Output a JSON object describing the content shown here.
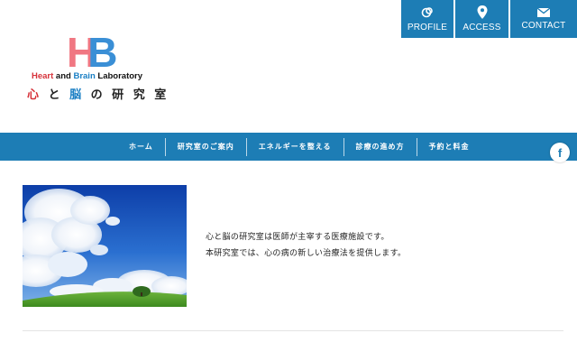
{
  "topnav": {
    "profile": "PROFILE",
    "access": "ACCESS",
    "contact": "CONTACT"
  },
  "logo": {
    "h": "H",
    "b": "B",
    "sub_heart": "Heart",
    "sub_and": " and ",
    "sub_brain": "Brain",
    "sub_lab": " Laboratory",
    "jp_1": "心",
    "jp_2": "と",
    "jp_3": "脳",
    "jp_4": "の 研 究 室"
  },
  "mainnav": {
    "items": [
      "ホーム",
      "研究室のご案内",
      "エネルギーを整える",
      "診療の進め方",
      "予約と料金"
    ]
  },
  "social": {
    "facebook": "f"
  },
  "intro": {
    "line1": "心と脳の研究室は医師が主宰する医療施設です。",
    "line2": "本研究室では、心の病の新しい治療法を提供します。"
  },
  "colors": {
    "brand_blue": "#1d7db5",
    "logo_red": "#f07782",
    "logo_blue": "#3a8fd6"
  }
}
